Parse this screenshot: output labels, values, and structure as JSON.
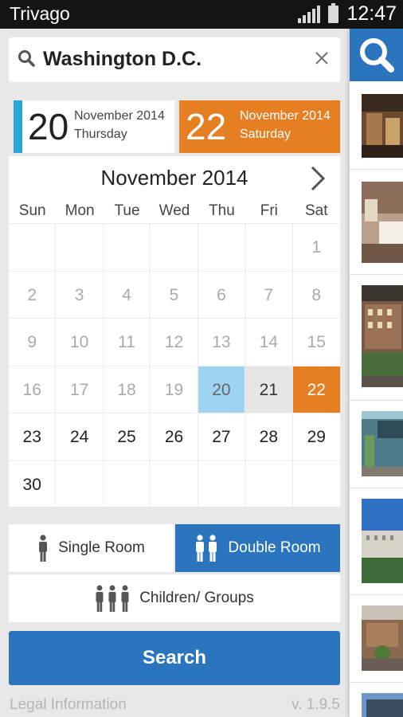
{
  "statusbar": {
    "app_name": "Trivago",
    "time": "12:47"
  },
  "search": {
    "destination": "Washington D.C."
  },
  "checkin": {
    "day": "20",
    "month": "November 2014",
    "weekday": "Thursday"
  },
  "checkout": {
    "day": "22",
    "month": "November 2014",
    "weekday": "Saturday"
  },
  "calendar": {
    "title": "November 2014",
    "weekdays": [
      "Sun",
      "Mon",
      "Tue",
      "Wed",
      "Thu",
      "Fri",
      "Sat"
    ],
    "first_weekday_index": 6,
    "days_in_month": 30,
    "today": 20,
    "selected_start": 20,
    "selected_end": 22
  },
  "rooms": {
    "single_label": "Single Room",
    "double_label": "Double Room",
    "groups_label": "Children/ Groups",
    "selected": "double"
  },
  "search_button": "Search",
  "footer": {
    "legal": "Legal Information",
    "version": "v. 1.9.5"
  },
  "colors": {
    "brand_blue": "#2a75bd",
    "accent_orange": "#e67e22",
    "checkin_blue": "#2aa3d9"
  }
}
